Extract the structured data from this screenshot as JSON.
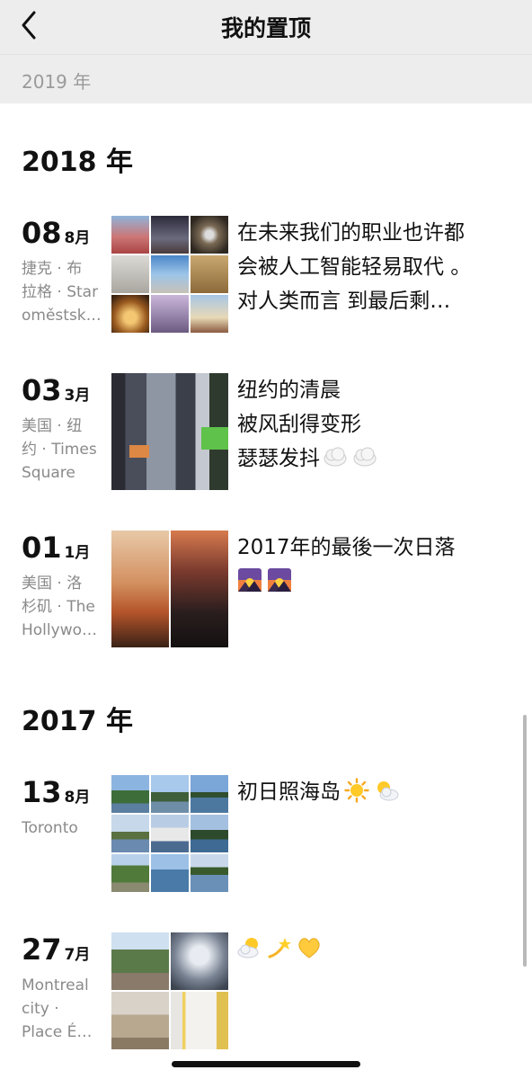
{
  "nav": {
    "title": "我的置顶",
    "back_icon": "chevron-left-icon"
  },
  "sticky_header": {
    "label": "2019 年"
  },
  "sections": [
    {
      "year": "2018 年",
      "entries": [
        {
          "day": "08",
          "month": "8月",
          "location_lines": [
            "捷克 · 布",
            "拉格 · Star",
            "oměstsk…"
          ],
          "text_lines": [
            "在未来我们的职业也许都",
            "会被人工智能轻易取代 。",
            "对人类而言 到最后剩…"
          ],
          "photos": "9-grid"
        },
        {
          "day": "03",
          "month": "3月",
          "location_lines": [
            "美国 · 纽",
            "约 · Times",
            "Square"
          ],
          "text_lines": [
            "纽约的清晨",
            "被风刮得变形",
            "瑟瑟发抖"
          ],
          "emoji": [
            "cloud-emoji",
            "cloud-emoji"
          ],
          "photos": "single"
        },
        {
          "day": "01",
          "month": "1月",
          "location_lines": [
            "美国 · 洛",
            "杉矶 · The",
            "Hollywo…"
          ],
          "text_lines": [
            "2017年的最後一次日落"
          ],
          "emoji": [
            "sunset-emoji",
            "sunset-emoji"
          ],
          "photos": "2-grid"
        }
      ]
    },
    {
      "year": "2017 年",
      "entries": [
        {
          "day": "13",
          "month": "8月",
          "location_lines": [
            "Toronto"
          ],
          "text_lines": [
            "初日照海岛"
          ],
          "emoji": [
            "sun-emoji",
            "sun-behind-cloud-emoji"
          ],
          "photos": "9-grid"
        },
        {
          "day": "27",
          "month": "7月",
          "location_lines": [
            "Montreal",
            "city ·",
            "Place É…"
          ],
          "text_lines": [
            ""
          ],
          "emoji": [
            "sun-behind-cloud-emoji",
            "dizzy-emoji",
            "yellow-heart-emoji"
          ],
          "photos": "4-grid"
        }
      ]
    }
  ]
}
